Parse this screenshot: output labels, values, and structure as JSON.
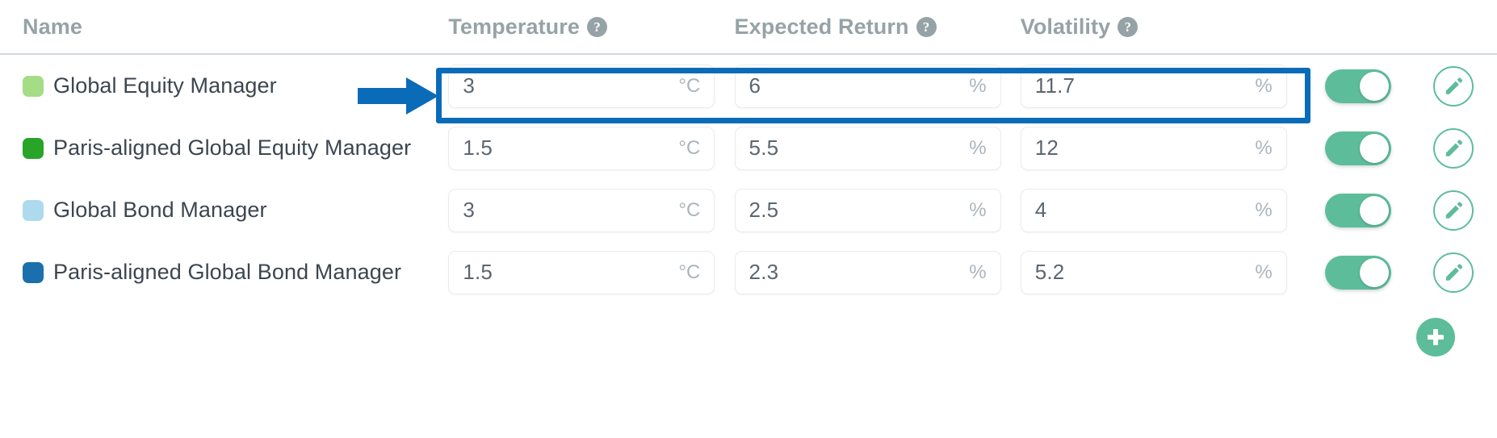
{
  "table": {
    "columns": [
      {
        "label": "Name",
        "help": false,
        "icon": ""
      },
      {
        "label": "Temperature",
        "help": true,
        "icon": "help-circle-icon"
      },
      {
        "label": "Expected Return",
        "help": true,
        "icon": "help-circle-icon"
      },
      {
        "label": "Volatility",
        "help": true,
        "icon": "help-circle-icon"
      }
    ],
    "rows": [
      {
        "name": "Global Equity Manager",
        "swatch_color": "#a5dc86",
        "temperature": {
          "value": "3",
          "unit": "°C"
        },
        "expected_return": {
          "value": "6",
          "unit": "%"
        },
        "volatility": {
          "value": "11.7",
          "unit": "%"
        },
        "enabled": true,
        "edit_icon": "pencil-icon"
      },
      {
        "name": "Paris-aligned Global Equity Manager",
        "swatch_color": "#28a428",
        "temperature": {
          "value": "1.5",
          "unit": "°C"
        },
        "expected_return": {
          "value": "5.5",
          "unit": "%"
        },
        "volatility": {
          "value": "12",
          "unit": "%"
        },
        "enabled": true,
        "edit_icon": "pencil-icon"
      },
      {
        "name": "Global Bond Manager",
        "swatch_color": "#addaed",
        "temperature": {
          "value": "3",
          "unit": "°C"
        },
        "expected_return": {
          "value": "2.5",
          "unit": "%"
        },
        "volatility": {
          "value": "4",
          "unit": "%"
        },
        "enabled": true,
        "edit_icon": "pencil-icon"
      },
      {
        "name": "Paris-aligned Global Bond Manager",
        "swatch_color": "#1b6fad",
        "temperature": {
          "value": "1.5",
          "unit": "°C"
        },
        "expected_return": {
          "value": "2.3",
          "unit": "%"
        },
        "volatility": {
          "value": "5.2",
          "unit": "%"
        },
        "enabled": true,
        "edit_icon": "pencil-icon"
      }
    ]
  },
  "add_button": {
    "icon": "plus-icon",
    "label": ""
  },
  "annotation": {
    "arrow_icon": "right-arrow-annotation",
    "highlight_icon": "highlight-box-annotation",
    "color": "#0a6cb8"
  },
  "theme": {
    "accent_green": "#5dbd9a",
    "header_text": "#96a3a6",
    "row_text": "#3c4650",
    "input_text": "#5c6670",
    "unit_text": "#aab4bb",
    "annotation_blue": "#0a6cb8"
  },
  "help_glyph": "?"
}
